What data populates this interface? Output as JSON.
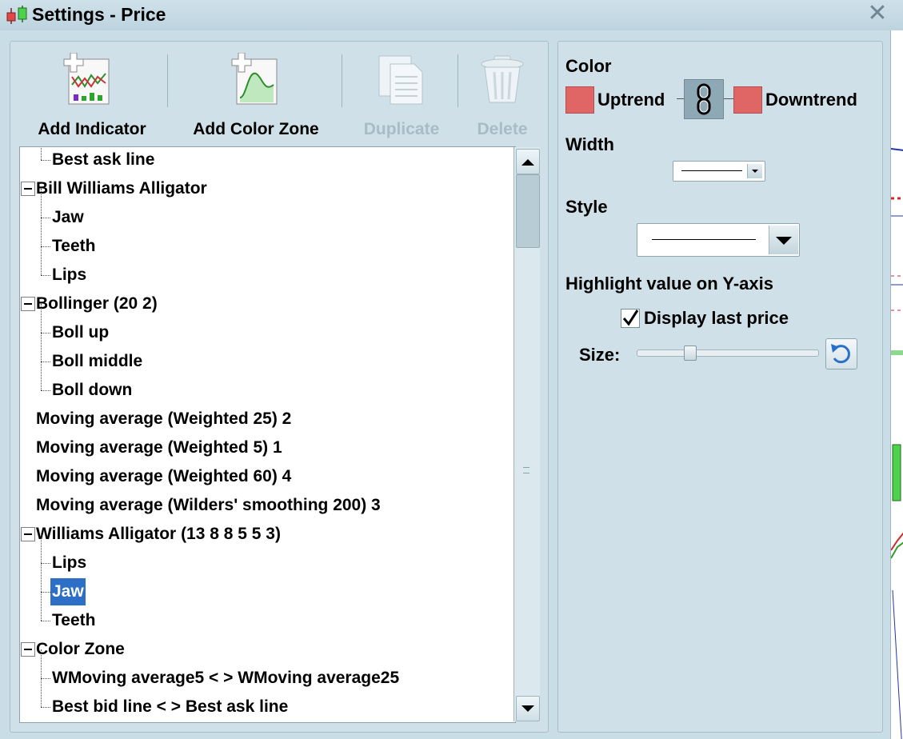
{
  "window": {
    "title": "Settings - Price"
  },
  "toolbar": {
    "add_indicator": "Add Indicator",
    "add_color_zone": "Add Color Zone",
    "duplicate": "Duplicate",
    "delete": "Delete"
  },
  "tree": {
    "rows": [
      {
        "label": "Best ask line",
        "level": 1
      },
      {
        "label": "Bill Williams Alligator",
        "level": 0,
        "expanded": true
      },
      {
        "label": "Jaw",
        "level": 1
      },
      {
        "label": "Teeth",
        "level": 1
      },
      {
        "label": "Lips",
        "level": 1
      },
      {
        "label": "Bollinger (20 2)",
        "level": 0,
        "expanded": true
      },
      {
        "label": "Boll up",
        "level": 1
      },
      {
        "label": "Boll middle",
        "level": 1
      },
      {
        "label": "Boll down",
        "level": 1
      },
      {
        "label": "Moving average (Weighted 25) 2",
        "level": 0
      },
      {
        "label": "Moving average (Weighted 5) 1",
        "level": 0
      },
      {
        "label": "Moving average (Weighted 60) 4",
        "level": 0
      },
      {
        "label": "Moving average (Wilders' smoothing 200) 3",
        "level": 0
      },
      {
        "label": "Williams Alligator (13 8 8 5 5 3)",
        "level": 0,
        "expanded": true
      },
      {
        "label": "Lips",
        "level": 1
      },
      {
        "label": "Jaw",
        "level": 1,
        "selected": true
      },
      {
        "label": "Teeth",
        "level": 1
      },
      {
        "label": "Color Zone",
        "level": 0,
        "expanded": true
      },
      {
        "label": "WMoving average5 < > WMoving average25",
        "level": 1
      },
      {
        "label": "Best bid line < > Best ask line",
        "level": 1
      }
    ]
  },
  "properties": {
    "color_heading": "Color",
    "uptrend_label": "Uptrend",
    "downtrend_label": "Downtrend",
    "uptrend_color": "#e06565",
    "downtrend_color": "#e06565",
    "width_heading": "Width",
    "style_heading": "Style",
    "highlight_heading": "Highlight value on Y-axis",
    "display_last_price_label": "Display last price",
    "display_last_price_checked": true,
    "size_label": "Size:",
    "size_value": 0.3
  }
}
